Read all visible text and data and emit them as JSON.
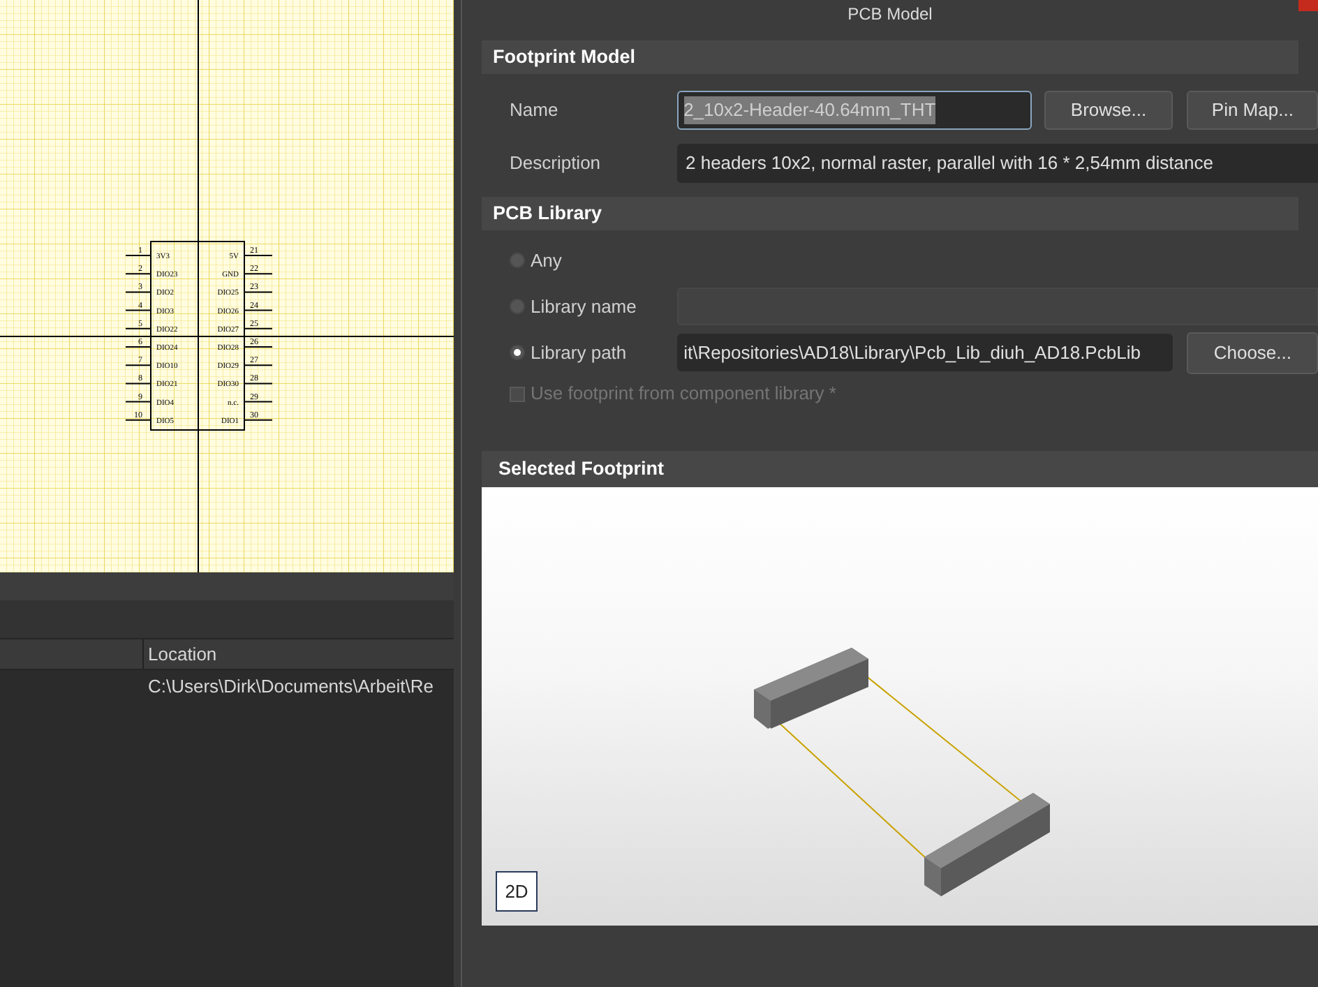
{
  "schematic": {
    "left_pins": [
      {
        "number": "1",
        "name": "3V3"
      },
      {
        "number": "2",
        "name": "DIO23"
      },
      {
        "number": "3",
        "name": "DIO2"
      },
      {
        "number": "4",
        "name": "DIO3"
      },
      {
        "number": "5",
        "name": "DIO22"
      },
      {
        "number": "6",
        "name": "DIO24"
      },
      {
        "number": "7",
        "name": "DIO10"
      },
      {
        "number": "8",
        "name": "DIO21"
      },
      {
        "number": "9",
        "name": "DIO4"
      },
      {
        "number": "10",
        "name": "DIO5"
      }
    ],
    "right_pins": [
      {
        "number": "21",
        "name": "5V"
      },
      {
        "number": "22",
        "name": "GND"
      },
      {
        "number": "23",
        "name": "DIO25"
      },
      {
        "number": "24",
        "name": "DIO26"
      },
      {
        "number": "25",
        "name": "DIO27"
      },
      {
        "number": "26",
        "name": "DIO28"
      },
      {
        "number": "27",
        "name": "DIO29"
      },
      {
        "number": "28",
        "name": "DIO30"
      },
      {
        "number": "29",
        "name": "n.c."
      },
      {
        "number": "30",
        "name": "DIO1"
      }
    ]
  },
  "table": {
    "columns": [
      "Location"
    ],
    "rows": [
      [
        "C:\\Users\\Dirk\\Documents\\Arbeit\\Re"
      ]
    ]
  },
  "dialog": {
    "title": "PCB Model",
    "footprint_model": {
      "heading": "Footprint Model",
      "name_label": "Name",
      "name_value": "2_10x2-Header-40.64mm_THT",
      "browse_button": "Browse...",
      "pin_map_button": "Pin Map...",
      "description_label": "Description",
      "description_value": "2 headers 10x2, normal raster, parallel with 16 * 2,54mm distance"
    },
    "pcb_library": {
      "heading": "PCB Library",
      "options": [
        {
          "label": "Any",
          "selected": false
        },
        {
          "label": "Library name",
          "selected": false
        },
        {
          "label": "Library path",
          "selected": true
        }
      ],
      "library_path_value": "it\\Repositories\\AD18\\Library\\Pcb_Lib_diuh_AD18.PcbLib",
      "choose_button": "Choose...",
      "use_component_library": {
        "label": "Use footprint from component library *",
        "checked": false,
        "disabled": true
      }
    },
    "selected_footprint": {
      "heading": "Selected Footprint",
      "view_button": "2D"
    }
  }
}
